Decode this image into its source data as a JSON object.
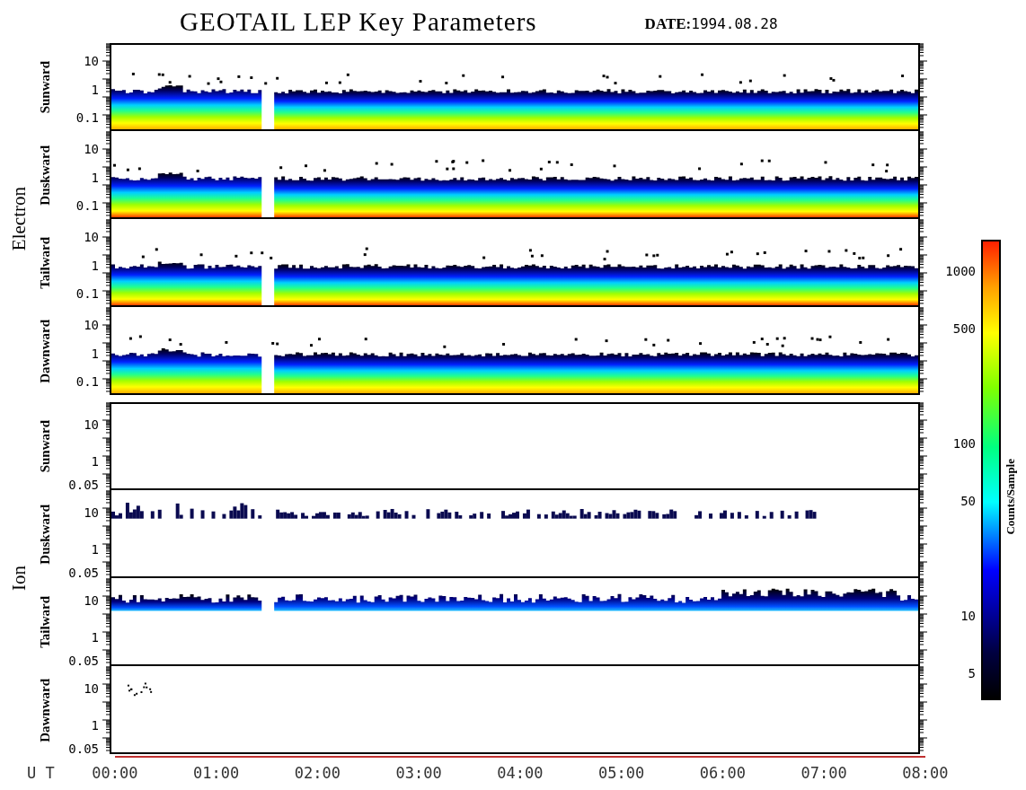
{
  "title": "GEOTAIL LEP Key Parameters",
  "date_label": "DATE:",
  "date": "1994.08.28",
  "groups": [
    {
      "name": "Electron",
      "kind": "electron",
      "panels": [
        {
          "direction": "Sunward",
          "kind": "band",
          "yticks": [
            "10",
            "1",
            "0.1"
          ]
        },
        {
          "direction": "Duskward",
          "kind": "band-hot",
          "yticks": [
            "10",
            "1",
            "0.1"
          ]
        },
        {
          "direction": "Tailward",
          "kind": "band-hot",
          "yticks": [
            "10",
            "1",
            "0.1"
          ]
        },
        {
          "direction": "Dawnward",
          "kind": "band",
          "yticks": [
            "10",
            "1",
            "0.1"
          ]
        }
      ]
    },
    {
      "name": "Ion",
      "kind": "ion",
      "panels": [
        {
          "direction": "Sunward",
          "kind": "empty",
          "yticks": [
            "10",
            "1",
            "0.05"
          ]
        },
        {
          "direction": "Duskward",
          "kind": "patches",
          "yticks": [
            "10",
            "1",
            "0.05"
          ]
        },
        {
          "direction": "Tailward",
          "kind": "ion-band",
          "yticks": [
            "10",
            "1",
            "0.05"
          ]
        },
        {
          "direction": "Dawnward",
          "kind": "dots",
          "yticks": [
            "10",
            "1",
            "0.05"
          ]
        }
      ]
    }
  ],
  "x_axis": {
    "label": "U T",
    "ticks": [
      "00:00",
      "01:00",
      "02:00",
      "03:00",
      "04:00",
      "05:00",
      "06:00",
      "07:00",
      "08:00"
    ]
  },
  "colorbar": {
    "label": "Counts/Sample",
    "ticks": [
      "1000",
      "500",
      "100",
      "50",
      "10",
      "5"
    ]
  }
}
